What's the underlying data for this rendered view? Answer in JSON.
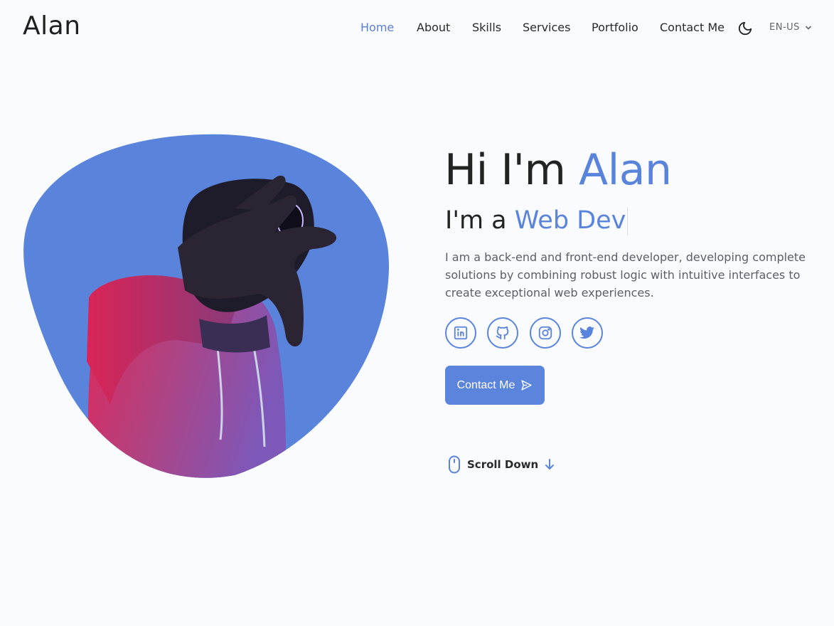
{
  "header": {
    "logo": "Alan",
    "nav": [
      {
        "label": "Home",
        "active": true
      },
      {
        "label": "About",
        "active": false
      },
      {
        "label": "Skills",
        "active": false
      },
      {
        "label": "Services",
        "active": false
      },
      {
        "label": "Portfolio",
        "active": false
      },
      {
        "label": "Contact Me",
        "active": false
      }
    ],
    "theme_icon": "moon-icon",
    "language": "EN-US"
  },
  "hero": {
    "greeting": "Hi I'm ",
    "name": "Alan",
    "role_prefix": "I'm a ",
    "role": "Web Dev",
    "description": "I am a back-end and front-end developer, developing complete solutions by combining robust logic with intuitive interfaces to create exceptional web experiences.",
    "socials": [
      "linkedin-icon",
      "github-icon",
      "instagram-icon",
      "twitter-icon"
    ],
    "cta_label": "Contact Me",
    "scroll_label": "Scroll Down"
  },
  "colors": {
    "accent": "#5a84dc",
    "background": "#f9fbfe",
    "text": "#232323"
  }
}
